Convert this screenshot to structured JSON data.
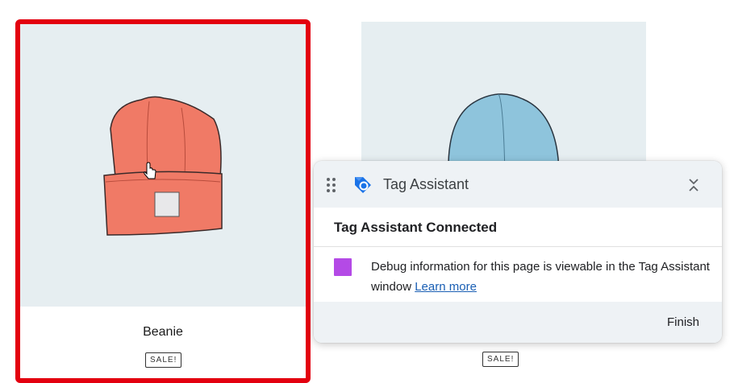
{
  "products": [
    {
      "title": "Beanie",
      "badge": "SALE!",
      "color": "#f07a66"
    },
    {
      "title": "",
      "badge": "SALE!",
      "color": "#8ec4dc"
    }
  ],
  "tag_assistant": {
    "title": "Tag Assistant",
    "status": "Tag Assistant Connected",
    "message": "Debug information for this page is viewable in the Tag Assistant window",
    "learn_more": "Learn more",
    "finish": "Finish",
    "swatch_color": "#b44ae6"
  }
}
